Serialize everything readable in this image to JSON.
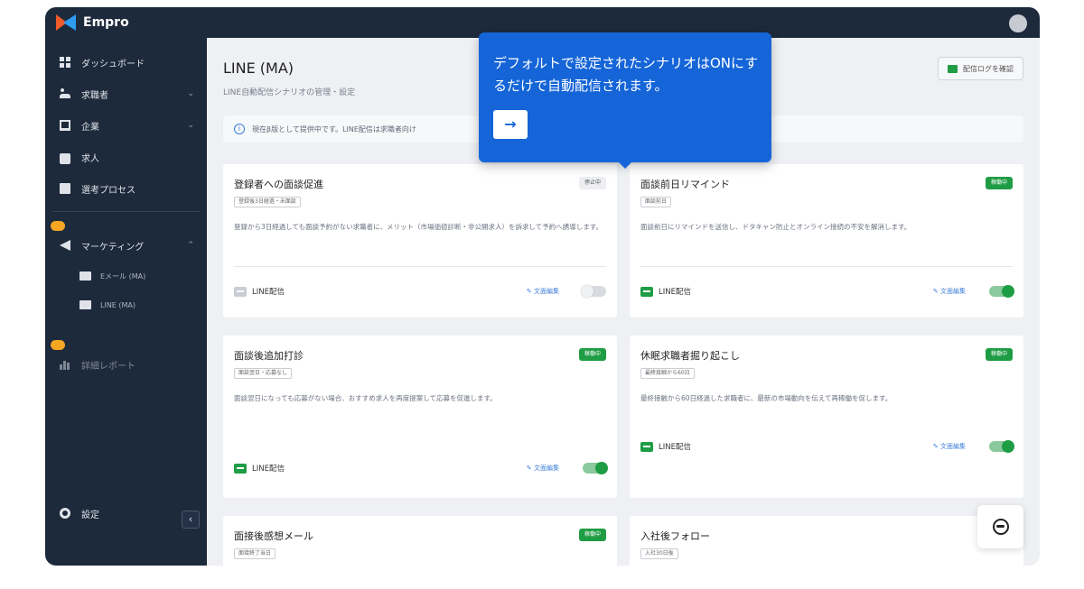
{
  "app": {
    "name": "Empro",
    "user_initial": ""
  },
  "sidebar": {
    "items": [
      {
        "label": "ダッシュボード"
      },
      {
        "label": "求職者",
        "chevron": "⌄"
      },
      {
        "label": "企業",
        "chevron": "⌄"
      },
      {
        "label": "求人"
      },
      {
        "label": "選考プロセス"
      },
      {
        "label": "マーケティング",
        "chevron": "⌃",
        "badge": ""
      },
      {
        "label": "Eメール (MA)"
      },
      {
        "label": "LINE (MA)"
      },
      {
        "label": "詳細レポート",
        "badge": ""
      }
    ],
    "settings_label": "設定",
    "collapse_glyph": "‹"
  },
  "header": {
    "title": "LINE (MA)",
    "subtitle": "LINE自動配信シナリオの管理・設定",
    "log_button_label": "配信ログを確認"
  },
  "banner": {
    "text": "現在β版として提供中です。LINE配信は求職者向け"
  },
  "tooltip": {
    "text": "デフォルトで設定されたシナリオはONにするだけで自動配信されます。",
    "next_glyph": "→"
  },
  "footer_label": "LINE配信",
  "edit_label": "文面編集",
  "cards": [
    {
      "title": "登録者への面談促進",
      "tag": "登録後3日経過・未面談",
      "status": "停止中",
      "on": false,
      "desc": "登録から3日経過しても面談予約がない求職者に、メリット（市場価値診断・非公開求人）を訴求して予約へ誘導します。"
    },
    {
      "title": "面談前日リマインド",
      "tag": "面談前日",
      "status": "稼働中",
      "on": true,
      "desc": "面談前日にリマインドを送信し、ドタキャン防止とオンライン接続の不安を解消します。"
    },
    {
      "title": "面談後追加打診",
      "tag": "面談翌日・応募なし",
      "status": "稼働中",
      "on": true,
      "desc": "面談翌日になっても応募がない場合、おすすめ求人を再度提案して応募を促進します。"
    },
    {
      "title": "休眠求職者掘り起こし",
      "tag": "最終接触から60日",
      "status": "稼働中",
      "on": true,
      "desc": "最終接触から60日経過した求職者に、最新の市場動向を伝えて再稼働を促します。"
    },
    {
      "title": "面接後感想メール",
      "tag": "面接終了当日",
      "status": "稼働中",
      "on": true
    },
    {
      "title": "入社後フォロー",
      "tag": "入社30日後"
    }
  ],
  "colors": {
    "sidebar_bg": "#1d2a3c",
    "accent_blue": "#1565d8",
    "status_green": "#1f9d45"
  }
}
